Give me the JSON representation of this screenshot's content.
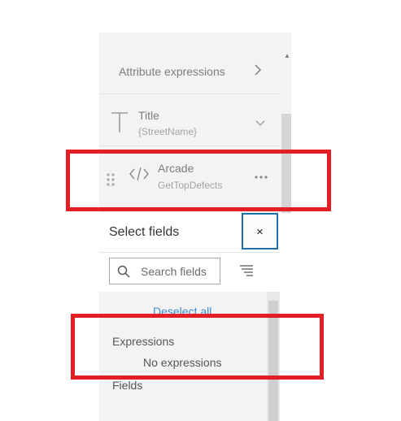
{
  "upper_panel": {
    "top_cut_text": "...",
    "attribute_expressions_label": "Attribute expressions",
    "title_label": "Title",
    "title_sub": "{StreetName}",
    "arcade_label": "Arcade",
    "arcade_sub": "GetTopDefects"
  },
  "select_fields": {
    "title": "Select fields",
    "close_glyph": "×",
    "search_placeholder": "Search fields",
    "deselect_all": "Deselect all",
    "expressions_heading": "Expressions",
    "no_expressions": "No expressions",
    "fields_heading": "Fields"
  },
  "icons": [
    "chevron-right-icon",
    "title-text-icon",
    "chevron-down-icon",
    "drag-handle-icon",
    "code-icon",
    "more-icon",
    "close-icon",
    "search-icon",
    "sort-icon"
  ],
  "colors": {
    "highlight": "#e31e24",
    "link": "#3d8cd1",
    "focus_border": "#1b6fa8"
  }
}
